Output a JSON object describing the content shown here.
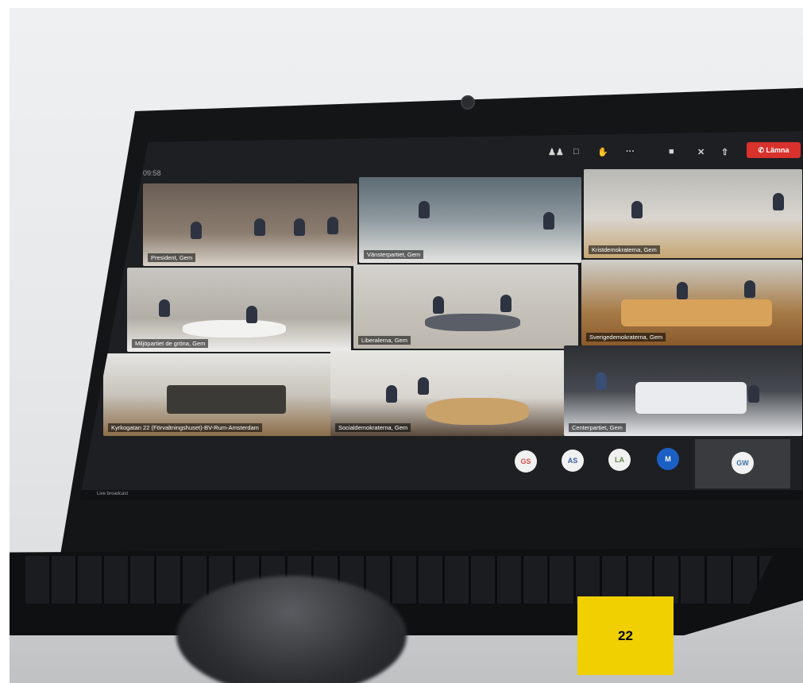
{
  "meeting": {
    "clock": "09:58",
    "toolbar_icons": [
      "people-icon",
      "chat-icon",
      "raise-hand-icon",
      "more-icon",
      "camera-off-icon",
      "mic-off-icon",
      "share-icon"
    ],
    "leave_label": "Lämna"
  },
  "tiles": [
    {
      "label": "President, Gem"
    },
    {
      "label": "Vänsterpartiet, Gem"
    },
    {
      "label": "Kristdemokraterna, Gem"
    },
    {
      "label": "Miljöpartiet de gröna, Gem"
    },
    {
      "label": "Liberalerna, Gem"
    },
    {
      "label": "Sverigedemokraterna, Gem"
    },
    {
      "label": "Kyrkogatan 22 (Förvaltningshuset)-BV-Rum-Amsterdam"
    },
    {
      "label": "Socialdemokraterna, Gem"
    },
    {
      "label": "Centerpartiet, Gem"
    }
  ],
  "avatars": [
    {
      "initials": "GS",
      "color": "#d8534f"
    },
    {
      "initials": "AS",
      "color": "#3b5ea8"
    },
    {
      "initials": "LA",
      "color": "#5f8a4a"
    },
    {
      "initials": "M",
      "color": "#1c5fc4"
    },
    {
      "initials": "GW",
      "color": "#3a6fa8"
    }
  ],
  "bottom_bar": {
    "text": "Live broadcast"
  },
  "page_number": "22"
}
